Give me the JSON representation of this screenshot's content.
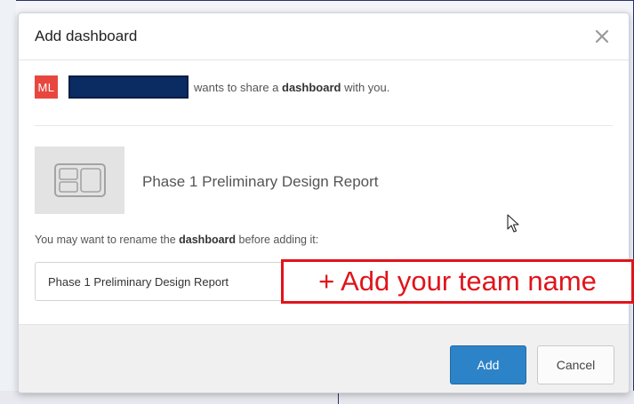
{
  "dialog": {
    "title": "Add dashboard",
    "close_icon": "close-icon"
  },
  "share": {
    "avatar_initials": "ML",
    "avatar_color": "#e8473f",
    "message_prefix": "wants to share a ",
    "message_bold": "dashboard",
    "message_suffix": " with you."
  },
  "dashboard": {
    "thumbnail_icon": "dashboard-layout-icon",
    "name": "Phase 1 Preliminary Design Report"
  },
  "rename": {
    "hint_prefix": "You may want to rename the ",
    "hint_bold": "dashboard",
    "hint_suffix": " before adding it:",
    "input_value": "Phase 1 Preliminary Design Report"
  },
  "annotation": {
    "text": "+ Add your team name",
    "color": "#e0141b"
  },
  "footer": {
    "add_label": "Add",
    "cancel_label": "Cancel",
    "accent_color": "#2d83c7"
  }
}
